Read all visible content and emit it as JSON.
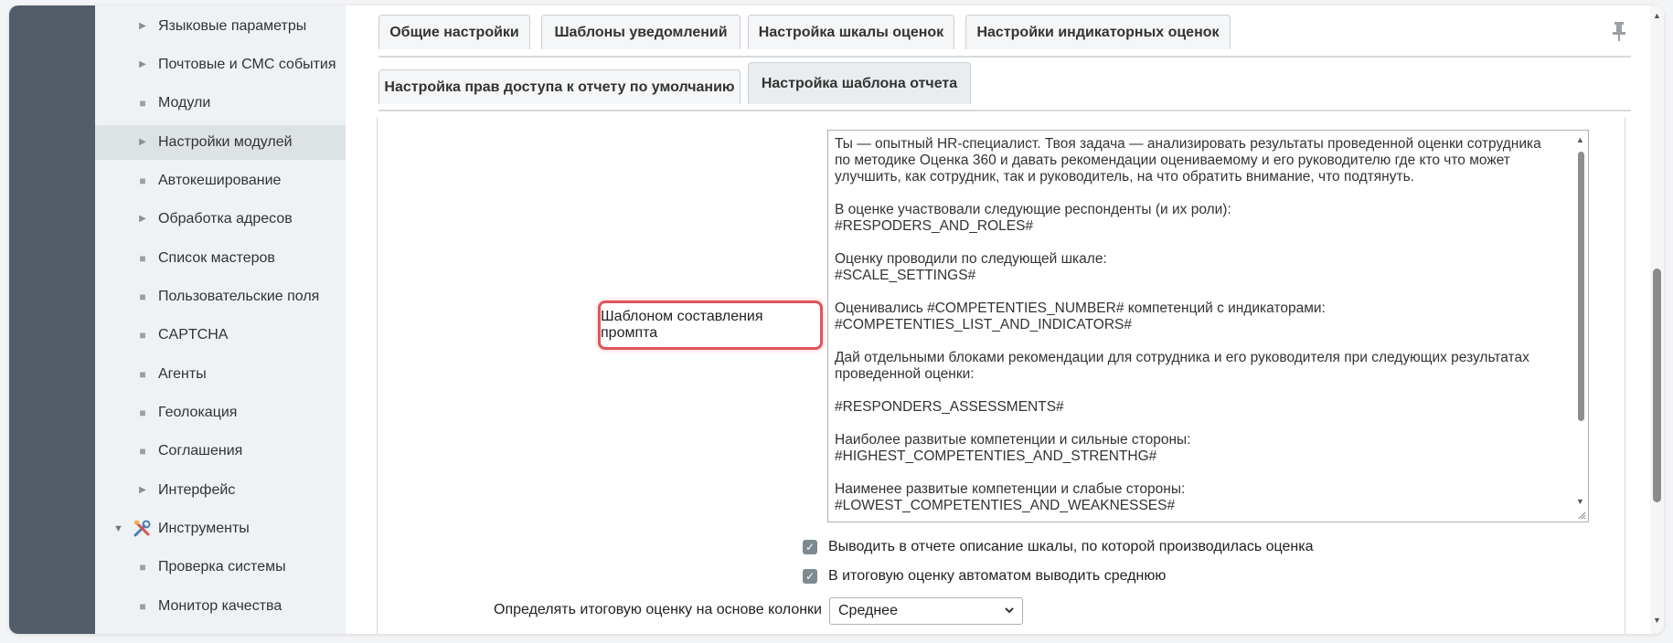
{
  "sidebar": {
    "items": [
      {
        "label": "Языковые параметры",
        "marker": "▶"
      },
      {
        "label": "Почтовые и СМС события",
        "marker": "▶"
      },
      {
        "label": "Модули",
        "marker": "■"
      },
      {
        "label": "Настройки модулей",
        "marker": "▶",
        "active": true
      },
      {
        "label": "Автокеширование",
        "marker": "■"
      },
      {
        "label": "Обработка адресов",
        "marker": "▶"
      },
      {
        "label": "Список мастеров",
        "marker": "■"
      },
      {
        "label": "Пользовательские поля",
        "marker": "■"
      },
      {
        "label": "CAPTCHA",
        "marker": "■"
      },
      {
        "label": "Агенты",
        "marker": "■"
      },
      {
        "label": "Геолокация",
        "marker": "■"
      },
      {
        "label": "Соглашения",
        "marker": "■"
      },
      {
        "label": "Интерфейс",
        "marker": "▶"
      },
      {
        "label": "Инструменты",
        "marker": "tools-icon",
        "expanded": true
      },
      {
        "label": "Проверка системы",
        "marker": "■"
      },
      {
        "label": "Монитор качества",
        "marker": "■"
      }
    ]
  },
  "tabs": {
    "row1": [
      {
        "label": "Общие настройки"
      },
      {
        "label": "Шаблоны уведомлений"
      },
      {
        "label": "Настройка шкалы оценок"
      },
      {
        "label": "Настройки индикаторных оценок"
      }
    ],
    "row2": [
      {
        "label": "Настройка прав доступа к отчету по умолчанию"
      },
      {
        "label": "Настройка шаблона отчета",
        "active": true
      }
    ]
  },
  "form": {
    "prompt_label": "Шаблоном составления промпта",
    "prompt_text": "Ты — опытный HR-специалист. Твоя задача — анализировать результаты проведенной оценки сотрудника по методике Оценка 360 и давать рекомендации оцениваемому и его руководителю где кто что может улучшить, как сотрудник, так и руководитель, на что обратить внимание, что подтянуть.\n\nВ оценке участвовали следующие респонденты (и их роли):\n#RESPODERS_AND_ROLES#\n\nОценку проводили по следующей шкале:\n#SCALE_SETTINGS#\n\nОценивались #COMPETENTIES_NUMBER# компетенций с индикаторами:\n#COMPETENTIES_LIST_AND_INDICATORS#\n\nДай отдельными блоками рекомендации для сотрудника и его руководителя при следующих результатах проведенной оценки:\n\n#RESPONDERS_ASSESSMENTS#\n\nНаиболее развитые компетенции и сильные стороны:\n#HIGHEST_COMPETENTIES_AND_STRENTHG#\n\nНаименее развитые компетенции и слабые стороны:\n#LOWEST_COMPETENTIES_AND_WEAKNESSES#",
    "checkbox1_label": "Выводить в отчете описание шкалы, по которой производилась оценка",
    "checkbox1_checked": true,
    "checkbox2_label": "В итоговую оценку автоматом выводить среднюю",
    "checkbox2_checked": true,
    "select_label": "Определять итоговую оценку на основе колонки",
    "select_value": "Среднее"
  },
  "icons": {
    "checkmark": "✓",
    "chevron_down": "⌄",
    "pin": "pin-icon"
  },
  "colors": {
    "highlight_border": "#e0565a",
    "dark_strip": "#535c69",
    "sidebar_bg": "#eef2f4",
    "checkbox_fill": "#7e8a92"
  }
}
